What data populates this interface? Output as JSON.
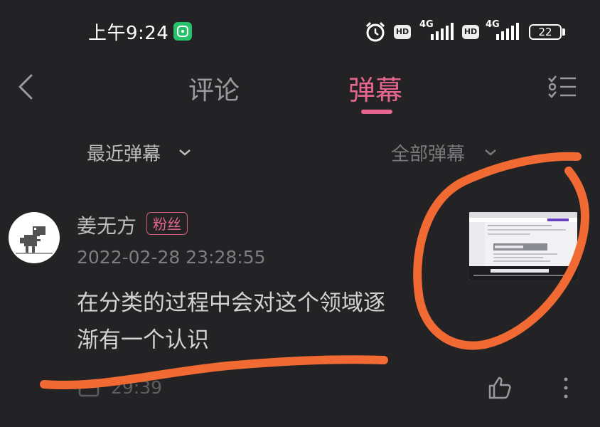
{
  "status_bar": {
    "time": "上午9:24",
    "network_1": "4G",
    "network_2": "4G",
    "hd_1": "HD",
    "hd_2": "HD",
    "battery": "22"
  },
  "header": {
    "tabs": [
      {
        "label": "评论",
        "active": false
      },
      {
        "label": "弹幕",
        "active": true
      }
    ]
  },
  "filters": {
    "recent": "最近弹幕",
    "all": "全部弹幕"
  },
  "comment": {
    "username": "姜无方",
    "badge": "粉丝",
    "timestamp": "2022-02-28 23:28:55",
    "text_line1": "在分类的过程中会对这个领域逐",
    "text_line2": "渐有一个认识",
    "playtime": "29:39"
  },
  "colors": {
    "background": "#232325",
    "accent": "#e5668f",
    "annotation": "#f26a33",
    "mi_badge": "#27c16b"
  },
  "icons": [
    "back-arrow-icon",
    "list-check-icon",
    "chevron-down-icon",
    "alarm-icon",
    "signal-icon",
    "battery-icon",
    "like-icon",
    "more-vertical-icon",
    "dino-avatar-icon",
    "play-count-icon"
  ]
}
